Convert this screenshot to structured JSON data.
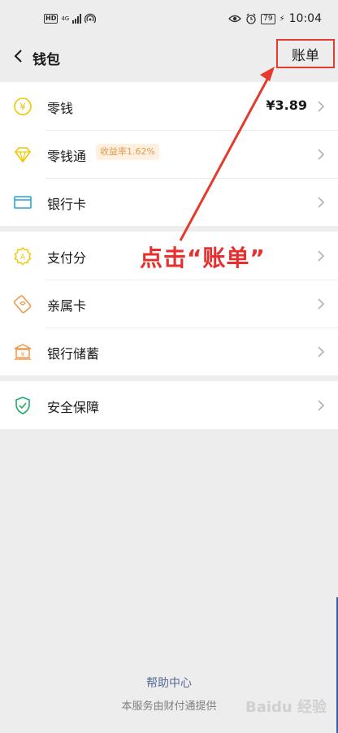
{
  "status_bar": {
    "hd": "HD",
    "network": "4G",
    "battery": "79",
    "time": "10:04"
  },
  "nav": {
    "title": "钱包",
    "bill_label": "账单"
  },
  "groups": [
    [
      {
        "label": "零钱",
        "amount": "¥3.89",
        "icon": "coin-icon",
        "color": "#f2c600"
      },
      {
        "label": "零钱通",
        "badge": "收益率1.62%",
        "icon": "diamond-icon",
        "color": "#f2c600"
      },
      {
        "label": "银行卡",
        "icon": "card-icon",
        "color": "#27a6d6"
      }
    ],
    [
      {
        "label": "支付分",
        "icon": "score-icon",
        "color": "#f2c600"
      },
      {
        "label": "亲属卡",
        "icon": "family-card-icon",
        "color": "#ef9a4c"
      },
      {
        "label": "银行储蓄",
        "icon": "bank-icon",
        "color": "#ef9a4c"
      }
    ],
    [
      {
        "label": "安全保障",
        "icon": "shield-icon",
        "color": "#1aad69"
      }
    ]
  ],
  "annotation": "点击“账单”",
  "footer": {
    "help": "帮助中心",
    "note": "本服务由财付通提供"
  },
  "watermark": "Baidu 经验",
  "colors": {
    "accent": "#e53a2e",
    "link": "#576b95"
  }
}
